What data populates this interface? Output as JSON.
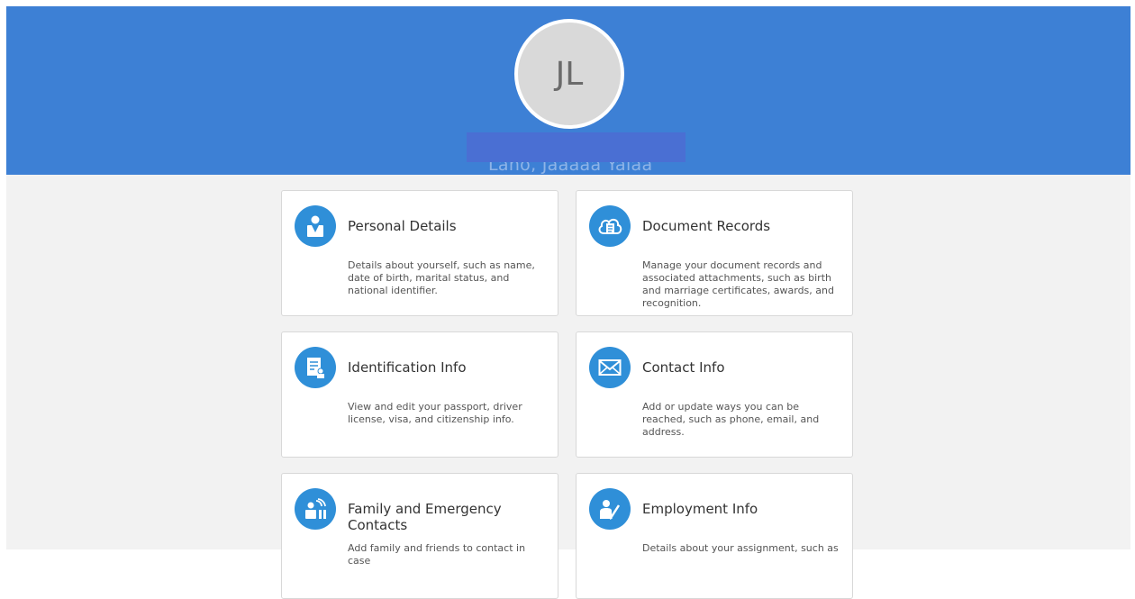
{
  "profile": {
    "initials": "JL",
    "name_partial": "Lano, Jaaaaa Yalaa"
  },
  "cards": [
    {
      "title": "Personal Details",
      "description": "Details about yourself, such as name, date of birth, marital status, and national identifier.",
      "icon": "person-icon"
    },
    {
      "title": "Document Records",
      "description": "Manage your document records and associated attachments, such as birth and marriage certificates, awards, and recognition.",
      "icon": "cloud-document-icon"
    },
    {
      "title": "Identification Info",
      "description": "View and edit your passport, driver license, visa, and citizenship info.",
      "icon": "id-document-icon"
    },
    {
      "title": "Contact Info",
      "description": "Add or update ways you can be reached, such as phone, email, and address.",
      "icon": "envelope-icon"
    },
    {
      "title": "Family and Emergency Contacts",
      "description": "Add family and friends to contact in case",
      "icon": "family-contacts-icon"
    },
    {
      "title": "Employment Info",
      "description": "Details about your assignment, such as",
      "icon": "employment-edit-icon"
    }
  ],
  "colors": {
    "header_bg": "#3d80d5",
    "content_bg": "#f2f2f2",
    "icon_bg": "#2f8fd8",
    "avatar_bg": "#d9d9d9"
  }
}
